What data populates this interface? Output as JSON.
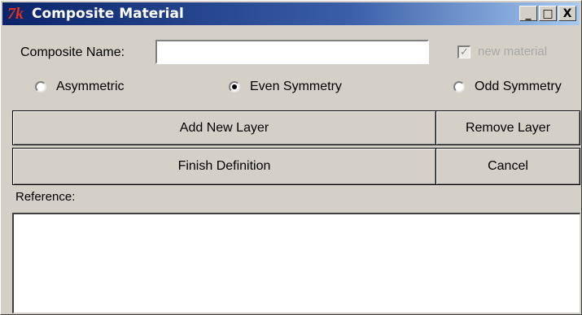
{
  "window": {
    "title": "Composite Material",
    "app_icon": "tk-icon",
    "app_icon_text": "7k",
    "controls": {
      "minimize": "_",
      "maximize": "□",
      "close": "X"
    }
  },
  "form": {
    "name_label": "Composite Name:",
    "name_value": "",
    "new_material_label": "new material",
    "new_material_checked": true,
    "new_material_mark": "✓"
  },
  "symmetry": {
    "options": [
      {
        "label": "Asymmetric",
        "selected": false
      },
      {
        "label": "Even Symmetry",
        "selected": true
      },
      {
        "label": "Odd Symmetry",
        "selected": false
      }
    ]
  },
  "buttons": {
    "add_layer": "Add New Layer",
    "remove_layer": "Remove Layer",
    "finish": "Finish Definition",
    "cancel": "Cancel"
  },
  "reference": {
    "label": "Reference:",
    "value": ""
  }
}
